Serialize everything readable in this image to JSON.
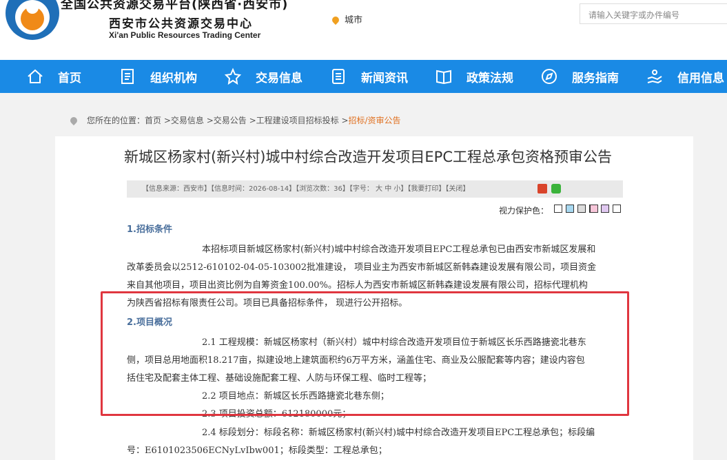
{
  "header": {
    "title_line1": "全国公共资源交易平台(陕西省·西安市)",
    "title_line2": "西安市公共资源交易中心",
    "title_line3": "Xi'an Public Resources Trading Center",
    "city_label": "城市",
    "search_placeholder": "请输入关键字或办件编号"
  },
  "nav": {
    "items": [
      {
        "label": "首页",
        "icon": "home-icon"
      },
      {
        "label": "组织机构",
        "icon": "document-icon"
      },
      {
        "label": "交易信息",
        "icon": "star-icon"
      },
      {
        "label": "新闻资讯",
        "icon": "list-icon"
      },
      {
        "label": "政策法规",
        "icon": "book-icon"
      },
      {
        "label": "服务指南",
        "icon": "compass-icon"
      },
      {
        "label": "信用信息",
        "icon": "hand-icon"
      }
    ]
  },
  "breadcrumb": {
    "prefix": "您所在的位置：",
    "path": "首页 >交易信息 >交易公告 >工程建设项目招标投标 >",
    "current": "招标/资审公告"
  },
  "article": {
    "title": "新城区杨家村(新兴村)城中村综合改造开发项目EPC工程总承包资格预审公告",
    "info": "【信息来源：西安市】【信息时间：2026-08-14】【浏览次数：36】【字号： 大 中 小】【我要打印】【关闭】",
    "eye_label": "视力保护色：",
    "swatches": [
      "#ffffff",
      "#a8d8f0",
      "#dcdcdc",
      "#f0f0f0",
      "#f7c6d9",
      "#e0c8f0",
      "#ffffff"
    ],
    "sec1": "1.招标条件",
    "p1_l1": "本招标项目新城区杨家村(新兴村)城中村综合改造开发项目EPC工程总承包已由西安市新城区发展和",
    "p1_l2": "改革委员会以2512-610102-04-05-103002批准建设， 项目业主为西安市新城区新韩森建设发展有限公司，项目资金",
    "p1_l3": "来自其他项目，项目出资比例为自筹资金100.00%。招标人为西安市新城区新韩森建设发展有限公司，招标代理机构",
    "p1_l4": "为陕西省招标有限责任公司。项目已具备招标条件， 现进行公开招标。",
    "sec2": "2.项目概况",
    "p21_l1": "2.1 工程规模：新城区杨家村（新兴村）城中村综合改造开发项目位于新城区长乐西路搪瓷北巷东",
    "p21_l2": "侧，项目总用地面积18.217亩，拟建设地上建筑面积约6万平方米，涵盖住宅、商业及公服配套等内容；建设内容包",
    "p21_l3": "括住宅及配套主体工程、基础设施配套工程、人防与环保工程、临时工程等；",
    "p22": "2.2 项目地点：新城区长乐西路搪瓷北巷东侧；",
    "p23": "2.3 项目投资总额：612180000元；",
    "p24_l1": "2.4 标段划分：标段名称：新城区杨家村(新兴村)城中村综合改造开发项目EPC工程总承包；标段编",
    "p24_l2": "号：E6101023506ECNyLvIbw001；标段类型：工程总承包；"
  }
}
